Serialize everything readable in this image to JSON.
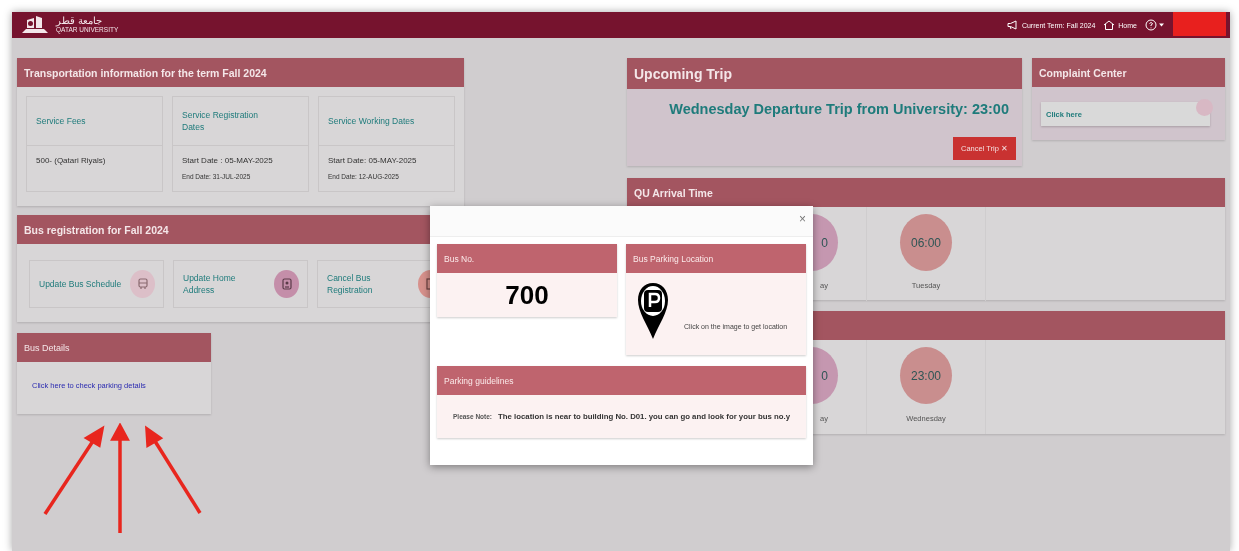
{
  "top_bar": {
    "logo": {
      "arabic": "جامعة قطر",
      "english": "QATAR UNIVERSITY"
    },
    "current_term": "Current Term: Fall 2024",
    "home": "Home"
  },
  "transportation_panel": {
    "title": "Transportation information for the term Fall 2024",
    "cards": [
      {
        "heading": "Service Fees",
        "main": "500- (Qatari Riyals)"
      },
      {
        "heading": "Service Registration Dates",
        "main": "Start Date : 05-MAY-2025",
        "sub": "End Date: 31-JUL-2025"
      },
      {
        "heading": "Service Working Dates",
        "main": "Start Date: 05-MAY-2025",
        "sub": "End Date: 12-AUG-2025"
      }
    ]
  },
  "registration_panel": {
    "title": "Bus registration for Fall 2024",
    "actions": [
      {
        "label": "Update Bus Schedule",
        "kind": "bus",
        "color": "#dcbfc8"
      },
      {
        "label": "Update Home Address",
        "kind": "contact",
        "color": "#c48ea9"
      },
      {
        "label": "Cancel Bus Registration",
        "kind": "cancel",
        "color": "#d7918c"
      }
    ]
  },
  "bus_details": {
    "title": "Bus Details",
    "link": "Click here to check parking details"
  },
  "upcoming_trip": {
    "title": "Upcoming Trip",
    "trip": "Wednesday Departure Trip from University: 23:00",
    "cancel_button": "Cancel Trip ✕"
  },
  "complaint_center": {
    "title": "Complaint Center",
    "link": "Click here"
  },
  "arrival_time": {
    "title": "QU Arrival Time",
    "slots": [
      {
        "time": "0",
        "day": "ay",
        "color": "#c597b0"
      },
      {
        "time": "06:00",
        "day": "Tuesday",
        "color": "#c98e8e"
      }
    ]
  },
  "departure_panel": {
    "slots": [
      {
        "time": "0",
        "day": "ay",
        "color": "#c597b0"
      },
      {
        "time": "23:00",
        "day": "Wednesday",
        "color": "#c98e8e"
      }
    ]
  },
  "modal": {
    "close": "×",
    "bus_no": {
      "title": "Bus No.",
      "number": "700"
    },
    "parking_location": {
      "title": "Bus Parking Location",
      "hint": "Click on the image to get location"
    },
    "guidelines": {
      "title": "Parking guidelines",
      "label": "Please Note:",
      "text": "The location is near to building No. D01. you can go and look for your bus no.y"
    }
  }
}
